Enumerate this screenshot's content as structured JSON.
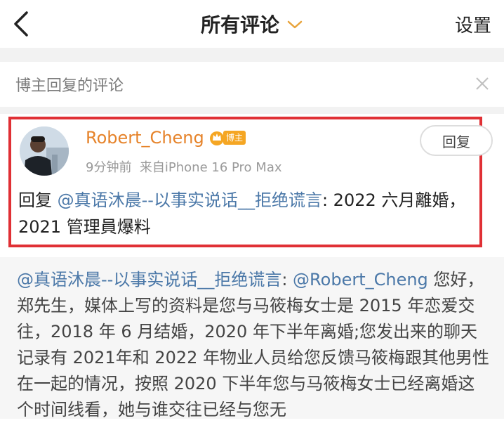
{
  "header": {
    "title": "所有评论",
    "settings_label": "设置"
  },
  "filter": {
    "label": "博主回复的评论"
  },
  "comment": {
    "username": "Robert_Cheng",
    "badge": "博主",
    "time": "9分钟前",
    "source": "来自iPhone 16 Pro Max",
    "reply_button": "回复",
    "reply_prefix": "回复",
    "mention": "@真语沐晨--以事实说话__拒绝谎言",
    "text_after_mention": ": 2022 六月離婚，2021 管理員爆料",
    "highlight_color": "#e03035"
  },
  "quoted": {
    "mention": "@真语沐晨--以事实说话__拒绝谎言",
    "colon": ": ",
    "mention2": "@Robert_Cheng",
    "text": " 您好，郑先生，媒体上写的资料是您与马筱梅女士是 2015 年恋爱交往，2018 年 6 月结婚，2020 年下半年离婚;您发出来的聊天记录有 2021年和 2022 年物业人员给您反馈马筱梅跟其他男性在一起的情况，按照 2020 下半年您与马筱梅女士已经离婚这个时间线看，她与谁交往已经与您无"
  },
  "colors": {
    "username": "#e6832a",
    "mention": "#4b78a8",
    "badge": "#f5a623"
  },
  "icons": {
    "back": "chevron-left-icon",
    "title_dropdown": "chevron-down-icon",
    "close": "close-icon",
    "badge": "crown-icon"
  }
}
